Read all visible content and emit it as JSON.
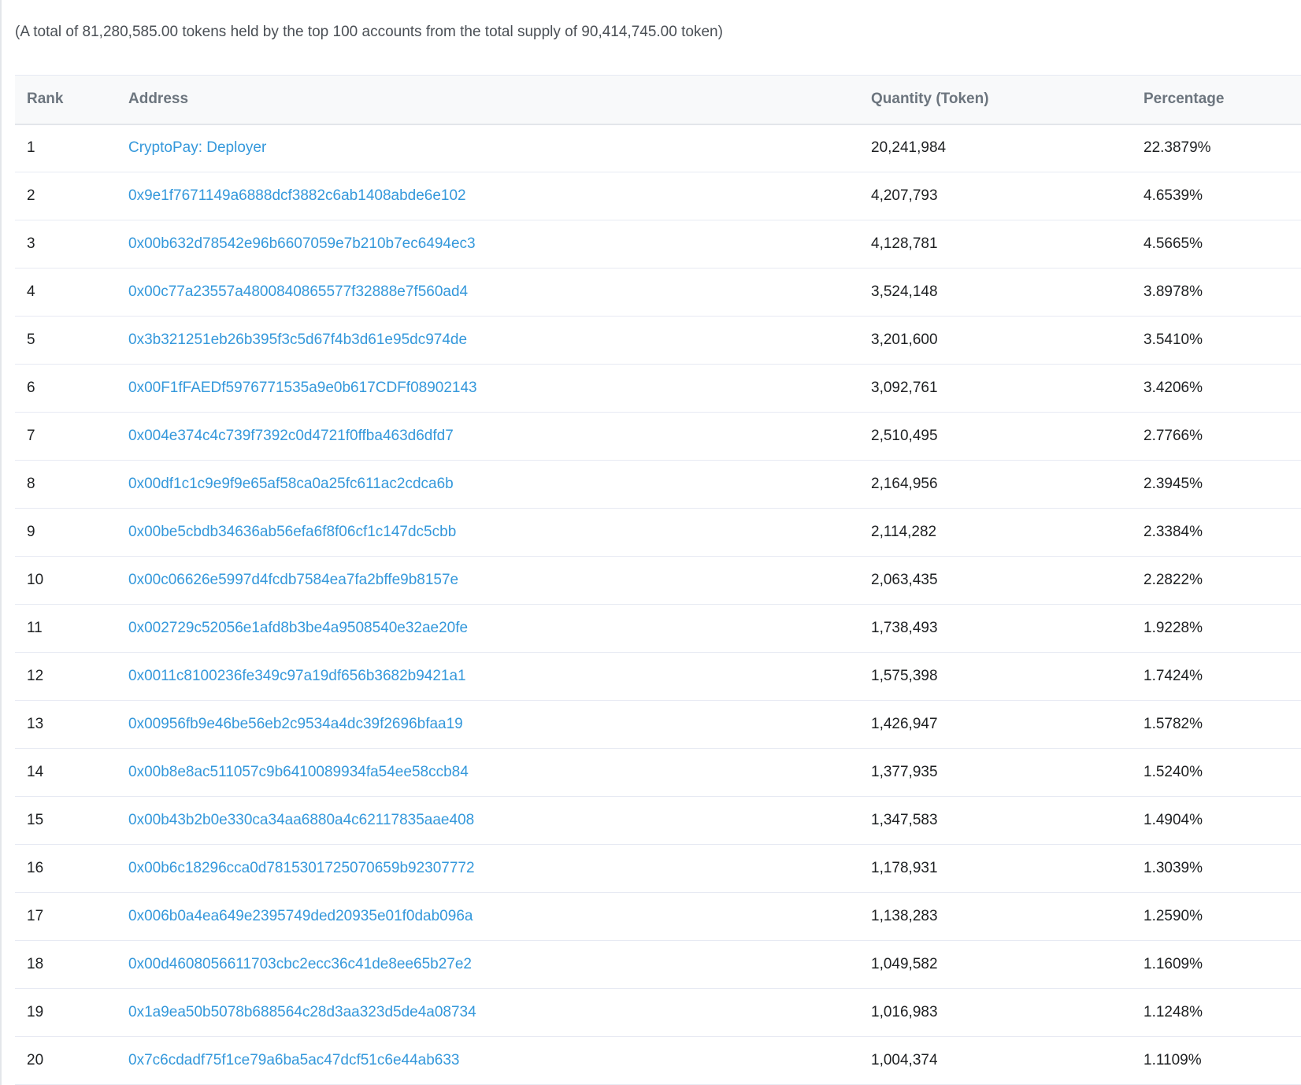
{
  "summary": "(A total of 81,280,585.00 tokens held by the top 100 accounts from the total supply of 90,414,745.00 token)",
  "colors": {
    "link": "#3498db",
    "header_bg": "#f8f9fa",
    "header_text": "#6c757e",
    "row_border": "#e7eaf3"
  },
  "table": {
    "headers": {
      "rank": "Rank",
      "address": "Address",
      "quantity": "Quantity (Token)",
      "percentage": "Percentage"
    },
    "rows": [
      {
        "rank": "1",
        "address": "CryptoPay: Deployer",
        "quantity": "20,241,984",
        "percentage": "22.3879%"
      },
      {
        "rank": "2",
        "address": "0x9e1f7671149a6888dcf3882c6ab1408abde6e102",
        "quantity": "4,207,793",
        "percentage": "4.6539%"
      },
      {
        "rank": "3",
        "address": "0x00b632d78542e96b6607059e7b210b7ec6494ec3",
        "quantity": "4,128,781",
        "percentage": "4.5665%"
      },
      {
        "rank": "4",
        "address": "0x00c77a23557a4800840865577f32888e7f560ad4",
        "quantity": "3,524,148",
        "percentage": "3.8978%"
      },
      {
        "rank": "5",
        "address": "0x3b321251eb26b395f3c5d67f4b3d61e95dc974de",
        "quantity": "3,201,600",
        "percentage": "3.5410%"
      },
      {
        "rank": "6",
        "address": "0x00F1fFAEDf5976771535a9e0b617CDFf08902143",
        "quantity": "3,092,761",
        "percentage": "3.4206%"
      },
      {
        "rank": "7",
        "address": "0x004e374c4c739f7392c0d4721f0ffba463d6dfd7",
        "quantity": "2,510,495",
        "percentage": "2.7766%"
      },
      {
        "rank": "8",
        "address": "0x00df1c1c9e9f9e65af58ca0a25fc611ac2cdca6b",
        "quantity": "2,164,956",
        "percentage": "2.3945%"
      },
      {
        "rank": "9",
        "address": "0x00be5cbdb34636ab56efa6f8f06cf1c147dc5cbb",
        "quantity": "2,114,282",
        "percentage": "2.3384%"
      },
      {
        "rank": "10",
        "address": "0x00c06626e5997d4fcdb7584ea7fa2bffe9b8157e",
        "quantity": "2,063,435",
        "percentage": "2.2822%"
      },
      {
        "rank": "11",
        "address": "0x002729c52056e1afd8b3be4a9508540e32ae20fe",
        "quantity": "1,738,493",
        "percentage": "1.9228%"
      },
      {
        "rank": "12",
        "address": "0x0011c8100236fe349c97a19df656b3682b9421a1",
        "quantity": "1,575,398",
        "percentage": "1.7424%"
      },
      {
        "rank": "13",
        "address": "0x00956fb9e46be56eb2c9534a4dc39f2696bfaa19",
        "quantity": "1,426,947",
        "percentage": "1.5782%"
      },
      {
        "rank": "14",
        "address": "0x00b8e8ac511057c9b6410089934fa54ee58ccb84",
        "quantity": "1,377,935",
        "percentage": "1.5240%"
      },
      {
        "rank": "15",
        "address": "0x00b43b2b0e330ca34aa6880a4c62117835aae408",
        "quantity": "1,347,583",
        "percentage": "1.4904%"
      },
      {
        "rank": "16",
        "address": "0x00b6c18296cca0d7815301725070659b92307772",
        "quantity": "1,178,931",
        "percentage": "1.3039%"
      },
      {
        "rank": "17",
        "address": "0x006b0a4ea649e2395749ded20935e01f0dab096a",
        "quantity": "1,138,283",
        "percentage": "1.2590%"
      },
      {
        "rank": "18",
        "address": "0x00d4608056611703cbc2ecc36c41de8ee65b27e2",
        "quantity": "1,049,582",
        "percentage": "1.1609%"
      },
      {
        "rank": "19",
        "address": "0x1a9ea50b5078b688564c28d3aa323d5de4a08734",
        "quantity": "1,016,983",
        "percentage": "1.1248%"
      },
      {
        "rank": "20",
        "address": "0x7c6cdadf75f1ce79a6ba5ac47dcf51c6e44ab633",
        "quantity": "1,004,374",
        "percentage": "1.1109%"
      }
    ]
  }
}
